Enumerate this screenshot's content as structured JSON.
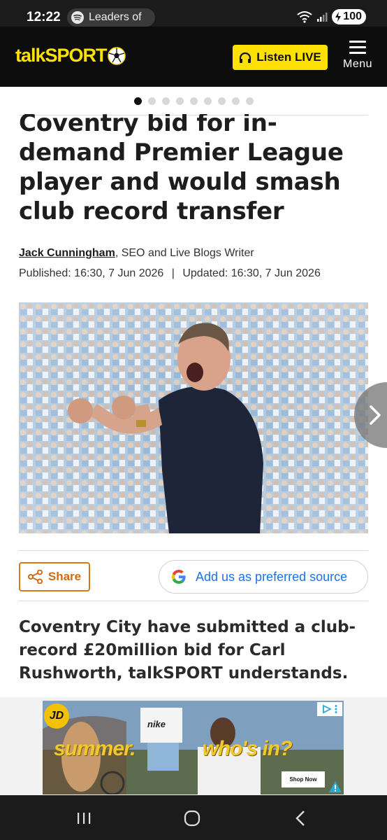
{
  "status_bar": {
    "time": "12:22",
    "media_text": "Leaders of",
    "battery": "100"
  },
  "header": {
    "logo_text": "talkSPORT",
    "listen_label": "Listen LIVE",
    "menu_label": "Menu",
    "brand_color": "#ffe100"
  },
  "carousel": {
    "dot_count": 9,
    "active_index": 0
  },
  "article": {
    "headline_lines": [
      "Coventry bid for in-",
      "demand Premier League",
      "player and would smash",
      "club record transfer"
    ],
    "author": "Jack Cunningham",
    "author_role": ", SEO and Live Blogs Writer",
    "published_label": "Published:",
    "published_value": "16:30, 7 Jun 2026",
    "separator": "|",
    "updated_label": "Updated:",
    "updated_value": "16:30, 7 Jun 2026",
    "standfirst_lines": [
      "Coventry City have submitted a club-",
      "record £20million bid for Carl",
      "Rushworth, talkSPORT understands."
    ]
  },
  "actions": {
    "share_label": "Share",
    "source_label": "Add us as preferred source",
    "share_color": "#d97a1a",
    "source_color": "#1a73e8"
  },
  "ad": {
    "brand": "JD",
    "slogan_left": "summer.",
    "slogan_right": "who's in?",
    "shirt_text": "nike",
    "cta": "Shop Now"
  },
  "icons": {
    "media": "spotify-icon",
    "headphones": "headphones-icon",
    "share": "share-icon",
    "google": "google-icon",
    "next": "chevron-right-icon"
  }
}
